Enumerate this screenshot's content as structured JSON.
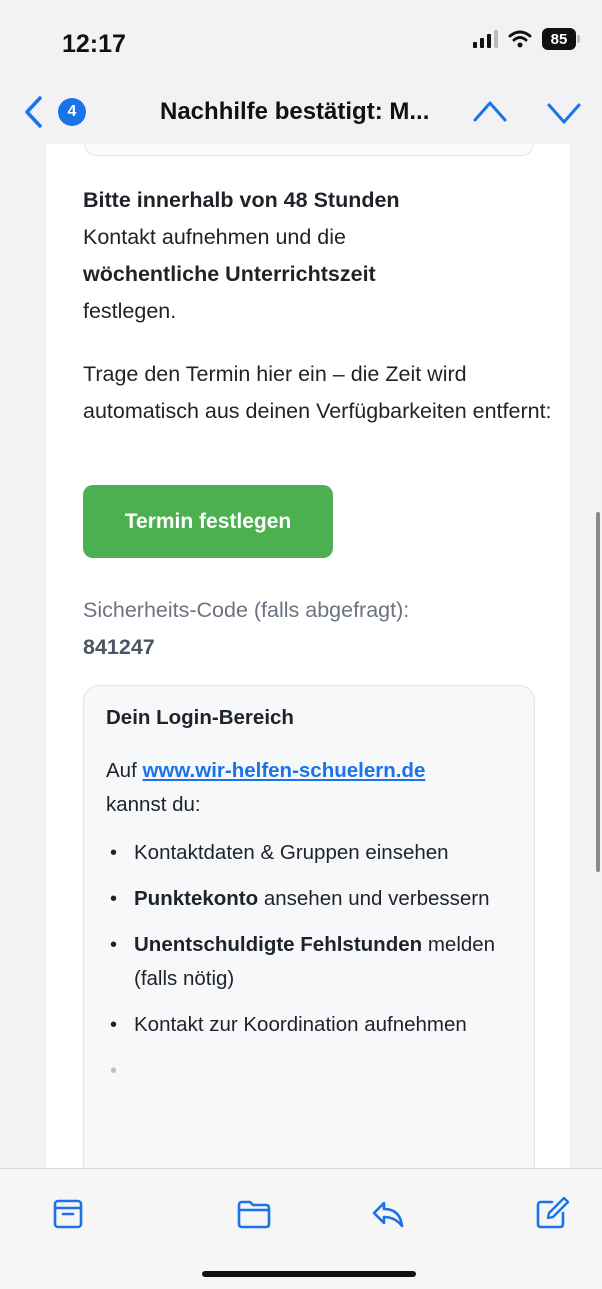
{
  "status_bar": {
    "time": "12:17",
    "battery_level": "85",
    "icons": [
      "signal-icon",
      "wifi-icon",
      "battery-icon"
    ]
  },
  "nav": {
    "unread_count": "4",
    "subject": "Nachhilfe bestätigt: M...",
    "icons": [
      "back-chevron-icon",
      "previous-message-icon",
      "next-message-icon"
    ]
  },
  "email": {
    "paragraph1": {
      "bold1": "Bitte innerhalb von 48 Stunden",
      "text1": "Kontakt aufnehmen und die",
      "bold2": "wöchentliche Unterrichtszeit",
      "text2": "festlegen."
    },
    "paragraph2": "Trage den Termin hier ein – die Zeit wird automatisch aus deinen Verfügbarkeiten entfernt:",
    "cta_label": "Termin festlegen",
    "security_label": "Sicherheits-Code (falls abgefragt):",
    "security_code": "841247",
    "login_box": {
      "title": "Dein Login-Bereich",
      "intro_prefix": "Auf",
      "link": "www.wir-helfen-schuelern.de",
      "intro_suffix": "kannst du:",
      "items": [
        {
          "bold": "",
          "text": "Kontaktdaten & Gruppen einsehen"
        },
        {
          "bold": "Punktekonto",
          "text": " ansehen und verbessern"
        },
        {
          "bold": "Unentschuldigte Fehlstunden",
          "text": " melden (falls nötig)"
        },
        {
          "bold": "",
          "text": "Kontakt zur Koordination aufnehmen"
        }
      ]
    }
  },
  "toolbar": {
    "icons": [
      "archive-icon",
      "move-folder-icon",
      "reply-icon",
      "compose-icon"
    ]
  },
  "colors": {
    "accent": "#1a73e8",
    "cta_green": "#4caf50"
  }
}
